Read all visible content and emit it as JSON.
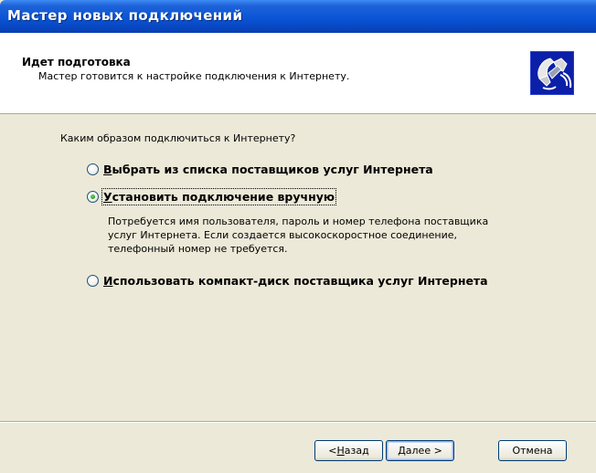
{
  "window": {
    "title": "Мастер новых подключений"
  },
  "header": {
    "title": "Идет подготовка",
    "subtitle": "Мастер готовится к настройке подключения к Интернету.",
    "icon": "phone-connection-icon"
  },
  "content": {
    "question": "Каким образом подключиться к Интернету?",
    "options": [
      {
        "accel": "В",
        "rest": "ыбрать из списка поставщиков услуг Интернета",
        "checked": false
      },
      {
        "accel": "У",
        "rest": "становить подключение вручную",
        "checked": true
      },
      {
        "accel": "И",
        "rest": "спользовать компакт-диск поставщика услуг Интернета",
        "checked": false
      }
    ],
    "description": [
      "Потребуется имя пользователя, пароль и  номер телефона поставщика",
      "услуг Интернета. Если создается высокоскоростное соединение,",
      "телефонный номер не требуется."
    ]
  },
  "buttons": {
    "back": {
      "prefix": "< ",
      "accel": "Н",
      "rest": "азад"
    },
    "next": {
      "accel": "Д",
      "rest": "алее >"
    },
    "cancel": {
      "label": "Отмена"
    }
  },
  "colors": {
    "titlebar": "#0a55d6",
    "dialog_bg": "#ece9d8",
    "header_bg": "#ffffff",
    "radio_selected": "#2fa82b"
  }
}
